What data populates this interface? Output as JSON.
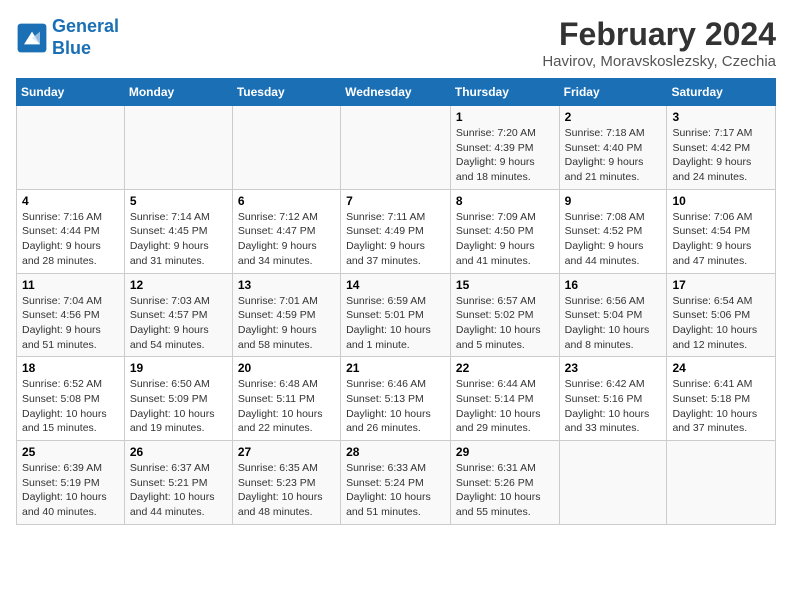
{
  "logo": {
    "line1": "General",
    "line2": "Blue"
  },
  "title": "February 2024",
  "location": "Havirov, Moravskoslezsky, Czechia",
  "weekdays": [
    "Sunday",
    "Monday",
    "Tuesday",
    "Wednesday",
    "Thursday",
    "Friday",
    "Saturday"
  ],
  "weeks": [
    [
      {
        "day": "",
        "info": ""
      },
      {
        "day": "",
        "info": ""
      },
      {
        "day": "",
        "info": ""
      },
      {
        "day": "",
        "info": ""
      },
      {
        "day": "1",
        "info": "Sunrise: 7:20 AM\nSunset: 4:39 PM\nDaylight: 9 hours\nand 18 minutes."
      },
      {
        "day": "2",
        "info": "Sunrise: 7:18 AM\nSunset: 4:40 PM\nDaylight: 9 hours\nand 21 minutes."
      },
      {
        "day": "3",
        "info": "Sunrise: 7:17 AM\nSunset: 4:42 PM\nDaylight: 9 hours\nand 24 minutes."
      }
    ],
    [
      {
        "day": "4",
        "info": "Sunrise: 7:16 AM\nSunset: 4:44 PM\nDaylight: 9 hours\nand 28 minutes."
      },
      {
        "day": "5",
        "info": "Sunrise: 7:14 AM\nSunset: 4:45 PM\nDaylight: 9 hours\nand 31 minutes."
      },
      {
        "day": "6",
        "info": "Sunrise: 7:12 AM\nSunset: 4:47 PM\nDaylight: 9 hours\nand 34 minutes."
      },
      {
        "day": "7",
        "info": "Sunrise: 7:11 AM\nSunset: 4:49 PM\nDaylight: 9 hours\nand 37 minutes."
      },
      {
        "day": "8",
        "info": "Sunrise: 7:09 AM\nSunset: 4:50 PM\nDaylight: 9 hours\nand 41 minutes."
      },
      {
        "day": "9",
        "info": "Sunrise: 7:08 AM\nSunset: 4:52 PM\nDaylight: 9 hours\nand 44 minutes."
      },
      {
        "day": "10",
        "info": "Sunrise: 7:06 AM\nSunset: 4:54 PM\nDaylight: 9 hours\nand 47 minutes."
      }
    ],
    [
      {
        "day": "11",
        "info": "Sunrise: 7:04 AM\nSunset: 4:56 PM\nDaylight: 9 hours\nand 51 minutes."
      },
      {
        "day": "12",
        "info": "Sunrise: 7:03 AM\nSunset: 4:57 PM\nDaylight: 9 hours\nand 54 minutes."
      },
      {
        "day": "13",
        "info": "Sunrise: 7:01 AM\nSunset: 4:59 PM\nDaylight: 9 hours\nand 58 minutes."
      },
      {
        "day": "14",
        "info": "Sunrise: 6:59 AM\nSunset: 5:01 PM\nDaylight: 10 hours\nand 1 minute."
      },
      {
        "day": "15",
        "info": "Sunrise: 6:57 AM\nSunset: 5:02 PM\nDaylight: 10 hours\nand 5 minutes."
      },
      {
        "day": "16",
        "info": "Sunrise: 6:56 AM\nSunset: 5:04 PM\nDaylight: 10 hours\nand 8 minutes."
      },
      {
        "day": "17",
        "info": "Sunrise: 6:54 AM\nSunset: 5:06 PM\nDaylight: 10 hours\nand 12 minutes."
      }
    ],
    [
      {
        "day": "18",
        "info": "Sunrise: 6:52 AM\nSunset: 5:08 PM\nDaylight: 10 hours\nand 15 minutes."
      },
      {
        "day": "19",
        "info": "Sunrise: 6:50 AM\nSunset: 5:09 PM\nDaylight: 10 hours\nand 19 minutes."
      },
      {
        "day": "20",
        "info": "Sunrise: 6:48 AM\nSunset: 5:11 PM\nDaylight: 10 hours\nand 22 minutes."
      },
      {
        "day": "21",
        "info": "Sunrise: 6:46 AM\nSunset: 5:13 PM\nDaylight: 10 hours\nand 26 minutes."
      },
      {
        "day": "22",
        "info": "Sunrise: 6:44 AM\nSunset: 5:14 PM\nDaylight: 10 hours\nand 29 minutes."
      },
      {
        "day": "23",
        "info": "Sunrise: 6:42 AM\nSunset: 5:16 PM\nDaylight: 10 hours\nand 33 minutes."
      },
      {
        "day": "24",
        "info": "Sunrise: 6:41 AM\nSunset: 5:18 PM\nDaylight: 10 hours\nand 37 minutes."
      }
    ],
    [
      {
        "day": "25",
        "info": "Sunrise: 6:39 AM\nSunset: 5:19 PM\nDaylight: 10 hours\nand 40 minutes."
      },
      {
        "day": "26",
        "info": "Sunrise: 6:37 AM\nSunset: 5:21 PM\nDaylight: 10 hours\nand 44 minutes."
      },
      {
        "day": "27",
        "info": "Sunrise: 6:35 AM\nSunset: 5:23 PM\nDaylight: 10 hours\nand 48 minutes."
      },
      {
        "day": "28",
        "info": "Sunrise: 6:33 AM\nSunset: 5:24 PM\nDaylight: 10 hours\nand 51 minutes."
      },
      {
        "day": "29",
        "info": "Sunrise: 6:31 AM\nSunset: 5:26 PM\nDaylight: 10 hours\nand 55 minutes."
      },
      {
        "day": "",
        "info": ""
      },
      {
        "day": "",
        "info": ""
      }
    ]
  ]
}
